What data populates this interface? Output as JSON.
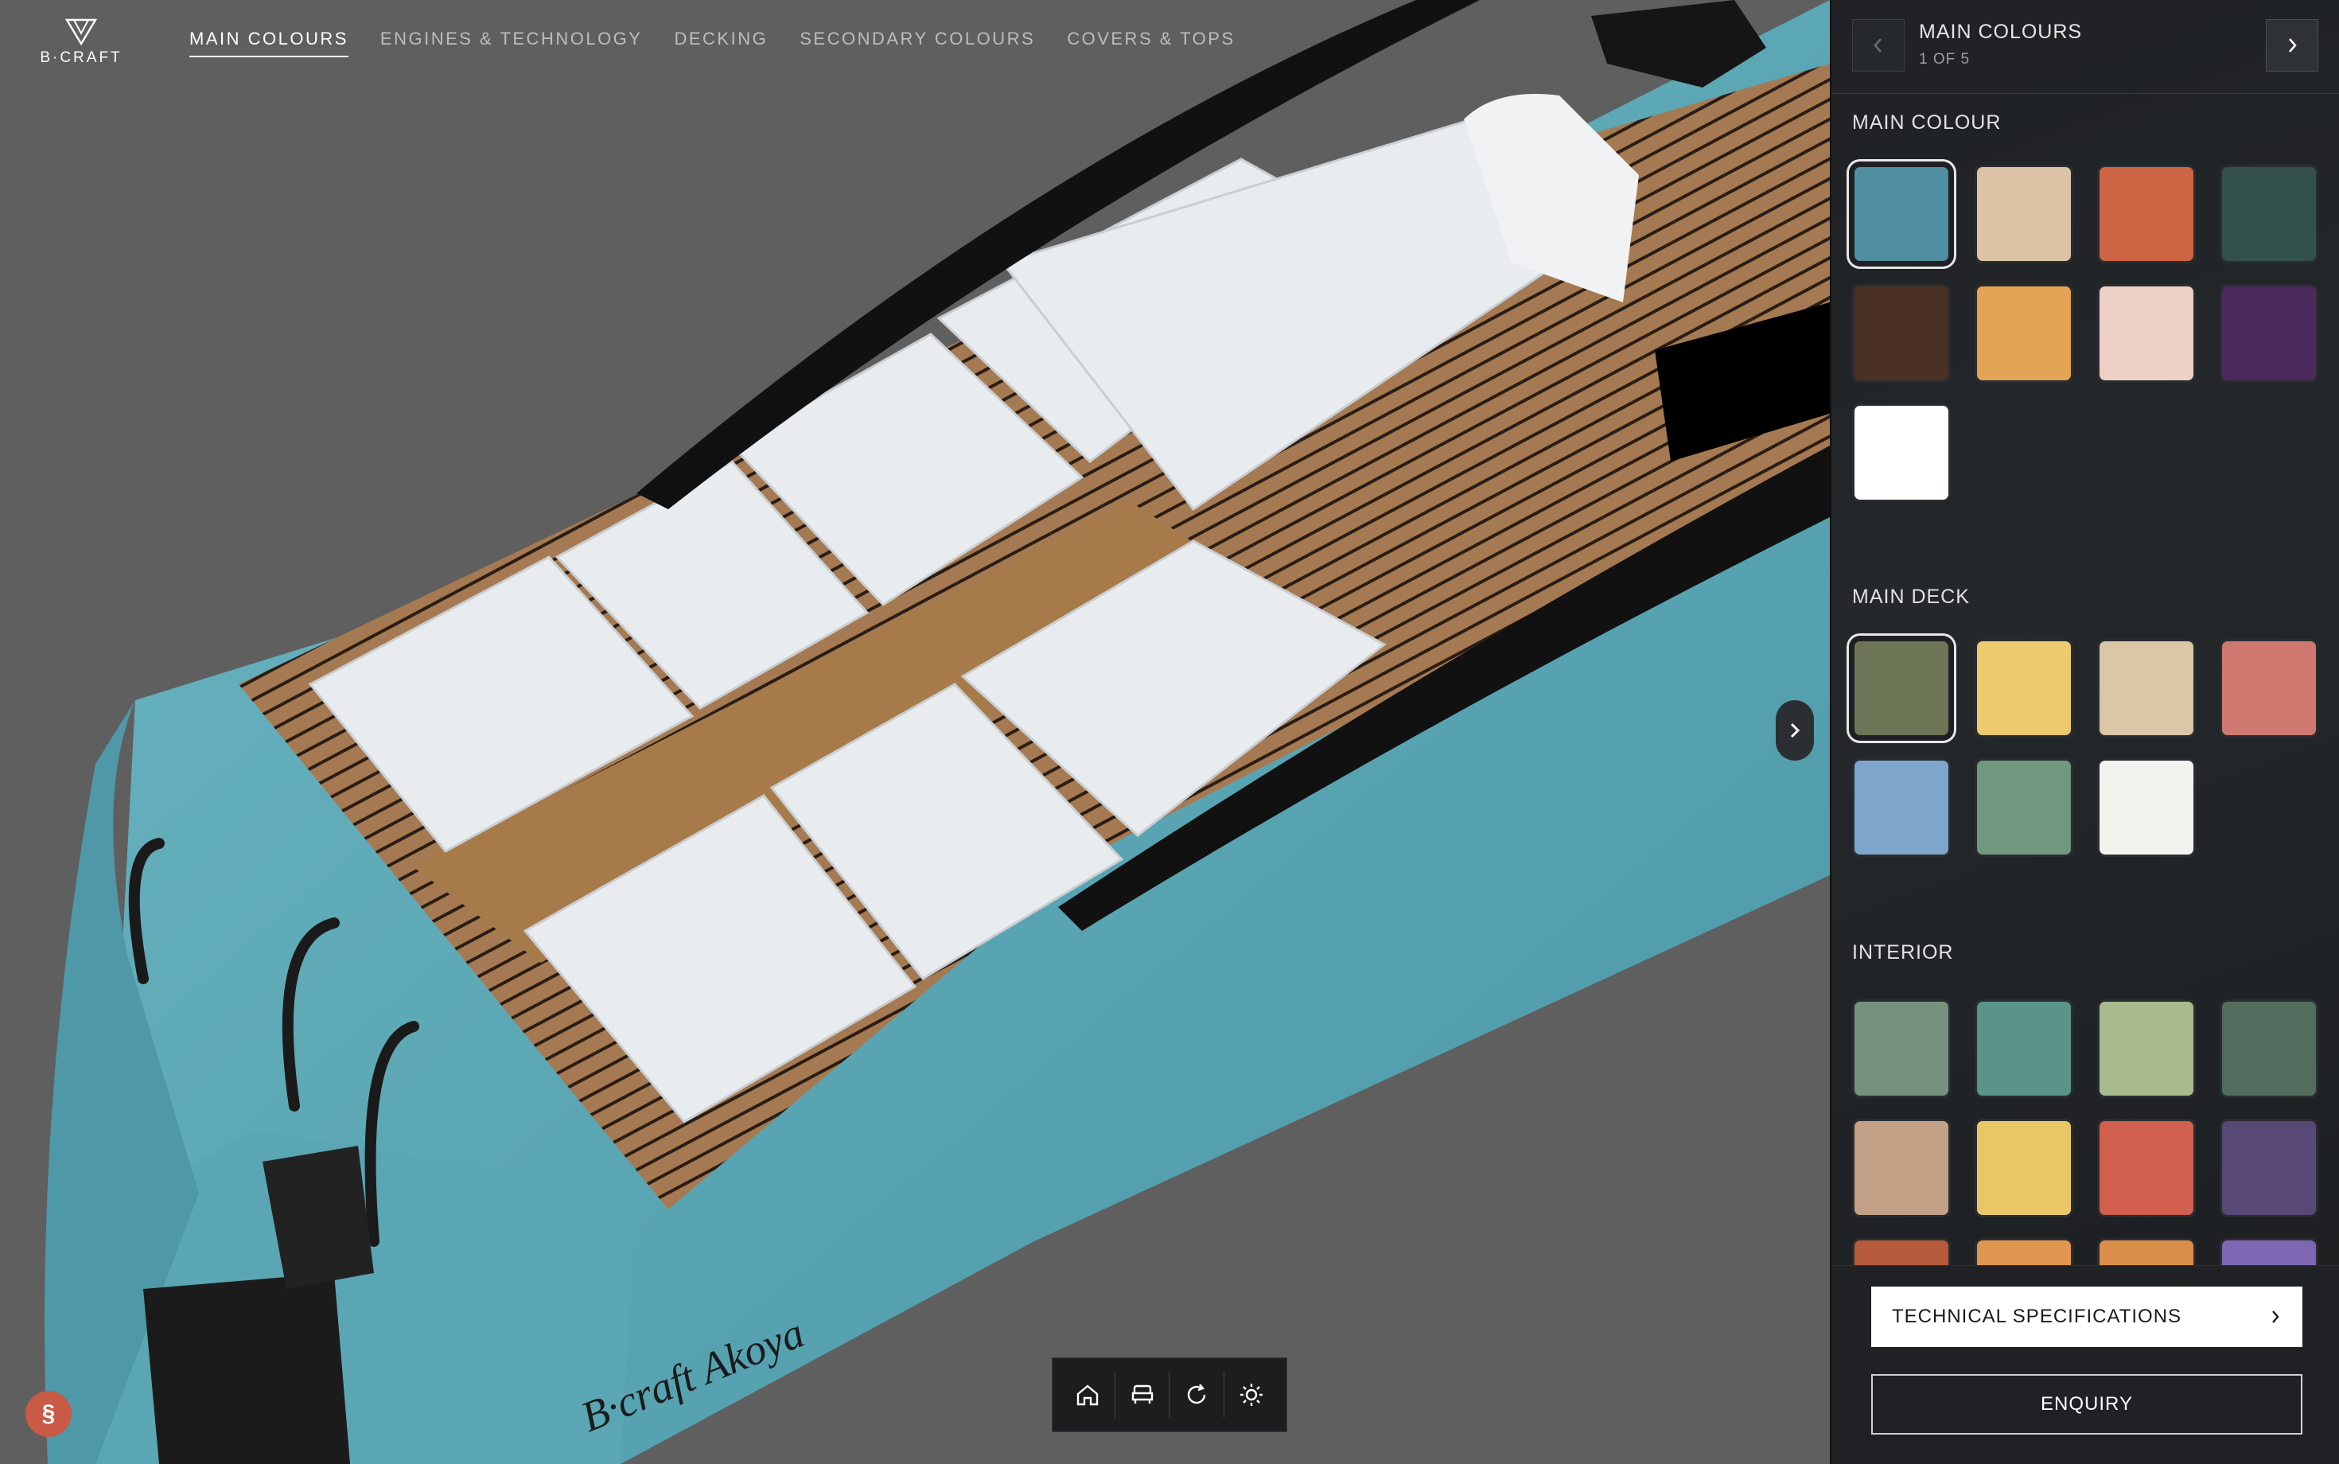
{
  "brand": {
    "logo_text": "B·CRAFT"
  },
  "nav": {
    "tabs": [
      {
        "label": "MAIN COLOURS",
        "active": true
      },
      {
        "label": "ENGINES & TECHNOLOGY"
      },
      {
        "label": "DECKING"
      },
      {
        "label": "SECONDARY COLOURS"
      },
      {
        "label": "COVERS & TOPS"
      }
    ]
  },
  "toolbar": {
    "icons": [
      "home-icon",
      "seat-icon",
      "reset-view-icon",
      "light-mode-icon"
    ]
  },
  "panel": {
    "header": {
      "title": "MAIN COLOURS",
      "step": "1 OF 5"
    },
    "sections": {
      "main_colour": {
        "title": "MAIN COLOUR",
        "selected_index": 0,
        "swatches": [
          "#4f8fa1",
          "#dcc3a6",
          "#cd6444",
          "#34504c",
          "#4a3124",
          "#e3a455",
          "#efd0c6",
          "#4b2b5e",
          "#ffffff"
        ]
      },
      "main_deck": {
        "title": "MAIN DECK",
        "selected_index": 0,
        "swatches": [
          "#6c7556",
          "#ecca6d",
          "#d9c7a7",
          "#cf7870",
          "#7ea6cc",
          "#6f987e",
          "#f2f3ee"
        ]
      },
      "interior": {
        "title": "INTERIOR",
        "swatches": [
          "#74927d",
          "#5a9488",
          "#a9bb8e",
          "#526c5d",
          "#c2a186",
          "#e9c766",
          "#d15f4e",
          "#584876",
          "#b55a3a",
          "#e0964f",
          "#d98e49",
          "#7d67b2"
        ]
      }
    },
    "buttons": {
      "spec_label": "TECHNICAL SPECIFICATIONS",
      "enquiry_label": "ENQUIRY"
    }
  },
  "badge": {
    "icon": "chat-widget-icon"
  },
  "hull_script": "B·craft Akoya"
}
